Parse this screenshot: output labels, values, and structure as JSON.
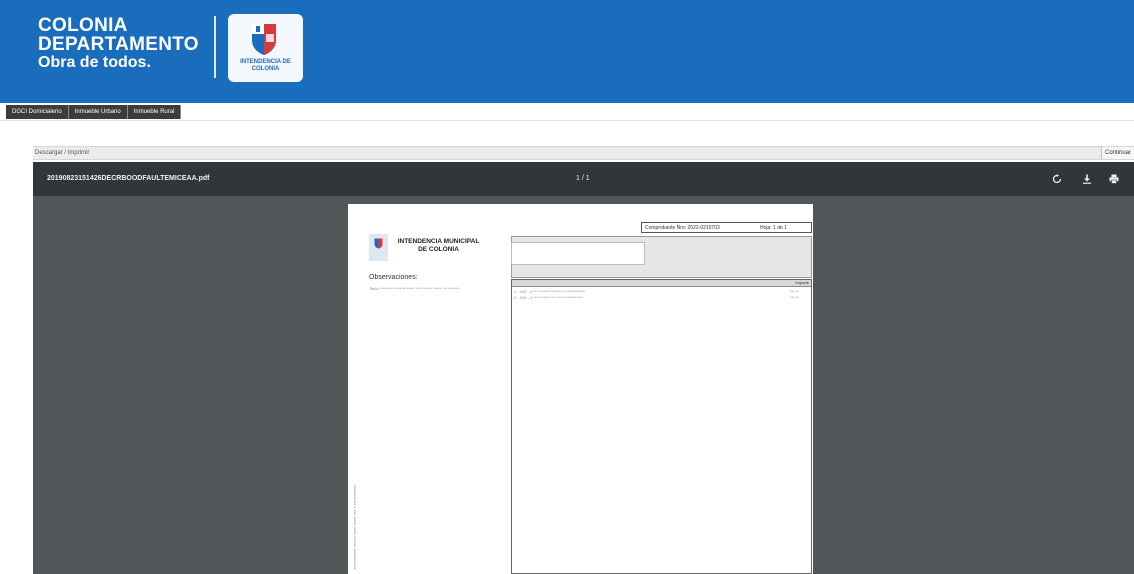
{
  "header": {
    "brand_line1": "COLONIA",
    "brand_line2": "DEPARTAMENTO",
    "brand_line3": "Obra de todos.",
    "logo_text": "INTENDENCIA DE COLONIA",
    "colors": {
      "bar": "#1a6dbd",
      "text": "#ffffff"
    }
  },
  "tabs": [
    {
      "label": "DGCI Domicialerio"
    },
    {
      "label": "Inmueble Urbano"
    },
    {
      "label": "Inmueble Rural"
    }
  ],
  "breadcrumb": {
    "text": "Descargar / Imprimir",
    "button_label": "Continuar"
  },
  "viewer": {
    "filename": "20190823151426DECRBOODFAULTEMICEAA.pdf",
    "page_indicator": "1 / 1",
    "icons": [
      "rotate-icon",
      "download-icon",
      "print-icon"
    ],
    "colors": {
      "toolbar": "#323639",
      "background": "#525659"
    }
  },
  "document": {
    "comprobante_label": "Comprobante Nro: 2022-0210703",
    "hoja_label": "Hoja: 1 de 1",
    "title_line1": "INTENDENCIA MUNICIPAL",
    "title_line2": "DE COLONIA",
    "observaciones_title": "Observaciones:",
    "observaciones_text": "Titulo ********* ******* ***** *** ******* ***** *** *******",
    "table_header": "Importe",
    "rows": [
      {
        "desc": "1 - 100 - 4 *** ******* ********* ************",
        "amount": "***.**"
      },
      {
        "desc": "2 - 100 - 4 *** ******* *** ***** ***********",
        "amount": "***.**"
      }
    ],
    "vertical_note": "************ ****** ***** ***** *** * ************"
  }
}
